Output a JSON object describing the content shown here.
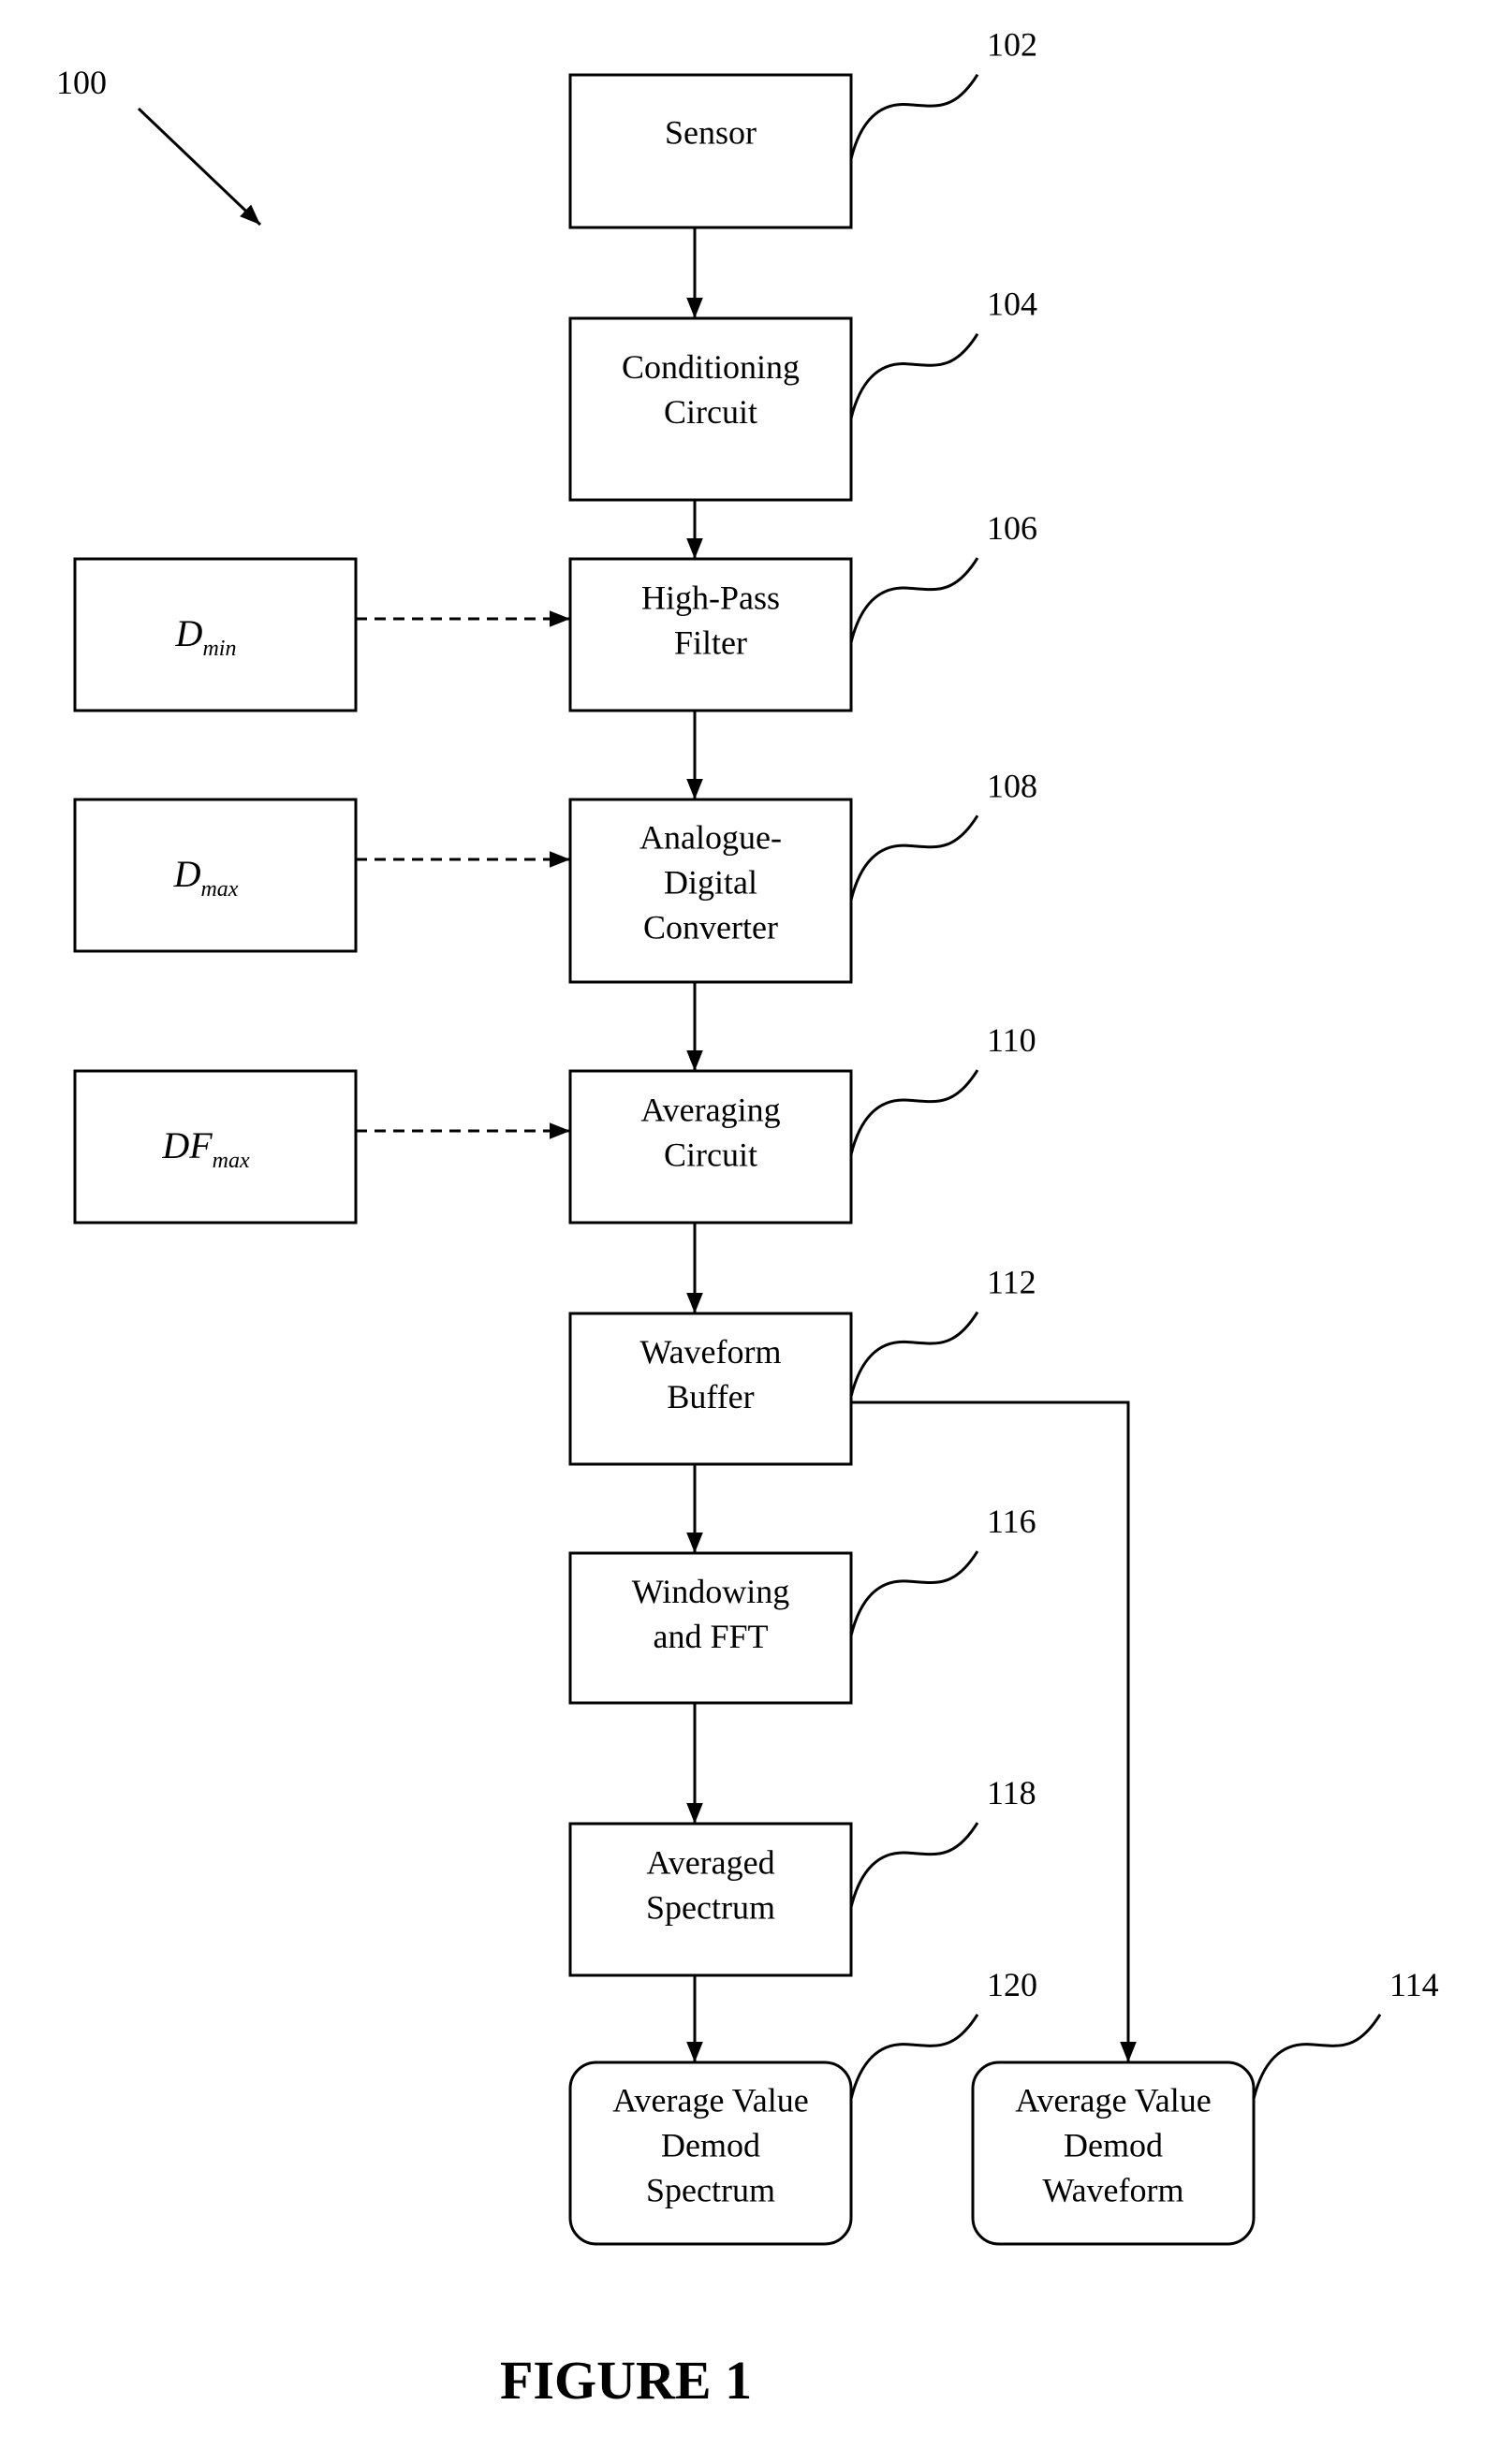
{
  "figure": {
    "title": "FIGURE 1",
    "reference": "100"
  },
  "blocks": {
    "sensor": {
      "ref": "102",
      "lines": [
        "Sensor"
      ]
    },
    "conditioning": {
      "ref": "104",
      "lines": [
        "Conditioning",
        "Circuit"
      ]
    },
    "high_pass": {
      "ref": "106",
      "lines": [
        "High-Pass",
        "Filter"
      ]
    },
    "adc": {
      "ref": "108",
      "lines": [
        "Analogue-",
        "Digital",
        "Converter"
      ]
    },
    "averaging": {
      "ref": "110",
      "lines": [
        "Averaging",
        "Circuit"
      ]
    },
    "waveform_buffer": {
      "ref": "112",
      "lines": [
        "Waveform",
        "Buffer"
      ]
    },
    "avd_waveform": {
      "ref": "114",
      "lines": [
        "Average Value",
        "Demod",
        "Waveform"
      ]
    },
    "windowing": {
      "ref": "116",
      "lines": [
        "Windowing",
        "and FFT"
      ]
    },
    "averaged_spectrum": {
      "ref": "118",
      "lines": [
        "Averaged",
        "Spectrum"
      ]
    },
    "avd_spectrum": {
      "ref": "120",
      "lines": [
        "Average Value",
        "Demod",
        "Spectrum"
      ]
    }
  },
  "parameters": {
    "dmin": {
      "base": "D",
      "sub": "min"
    },
    "dmax": {
      "base": "D",
      "sub": "max"
    },
    "dfmax": {
      "base": "DF",
      "sub": "max"
    }
  }
}
